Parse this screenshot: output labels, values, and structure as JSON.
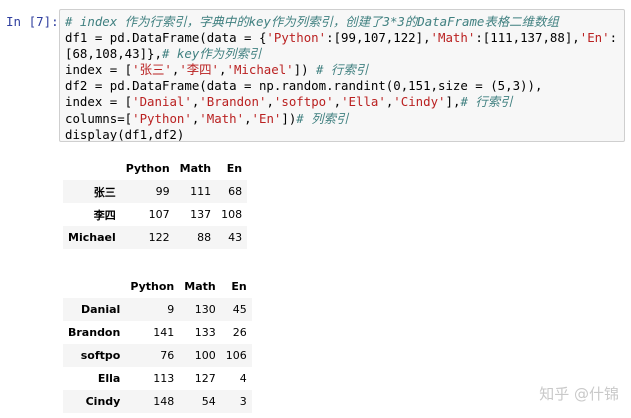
{
  "cell": {
    "prompt": "In [7]:",
    "code_lines": [
      [
        [
          "cm",
          "# index 作为行索引，字典中的key作为列索引，创建了3*3的DataFrame表格二维数组"
        ]
      ],
      [
        [
          "",
          "df1 = pd.DataFrame(data = {"
        ],
        [
          "st",
          "'Python'"
        ],
        [
          "",
          ":[99,107,122],"
        ],
        [
          "st",
          "'Math'"
        ],
        [
          "",
          ":[111,137,88],"
        ],
        [
          "st",
          "'En'"
        ],
        [
          "",
          ":"
        ]
      ],
      [
        [
          "",
          "[68,108,43]},"
        ],
        [
          "cm",
          "# key作为列索引"
        ]
      ],
      [
        [
          "",
          "index = ["
        ],
        [
          "st",
          "'张三'"
        ],
        [
          "",
          ","
        ],
        [
          "st",
          "'李四'"
        ],
        [
          "",
          ","
        ],
        [
          "st",
          "'Michael'"
        ],
        [
          "",
          "]) "
        ],
        [
          "cm",
          "# 行索引"
        ]
      ],
      [
        [
          "",
          "df2 = pd.DataFrame(data = np.random.randint(0,151,size = (5,3)),"
        ]
      ],
      [
        [
          "",
          "index = ["
        ],
        [
          "st",
          "'Danial'"
        ],
        [
          "",
          ","
        ],
        [
          "st",
          "'Brandon'"
        ],
        [
          "",
          ","
        ],
        [
          "st",
          "'softpo'"
        ],
        [
          "",
          ","
        ],
        [
          "st",
          "'Ella'"
        ],
        [
          "",
          ","
        ],
        [
          "st",
          "'Cindy'"
        ],
        [
          "",
          "],"
        ],
        [
          "cm",
          "# 行索引"
        ]
      ],
      [
        [
          "",
          "columns=["
        ],
        [
          "st",
          "'Python'"
        ],
        [
          "",
          ","
        ],
        [
          "st",
          "'Math'"
        ],
        [
          "",
          ","
        ],
        [
          "st",
          "'En'"
        ],
        [
          "",
          "])"
        ],
        [
          "cm",
          "# 列索引"
        ]
      ],
      [
        [
          "",
          "display(df1,df2)"
        ]
      ]
    ]
  },
  "df1": {
    "columns": [
      "Python",
      "Math",
      "En"
    ],
    "rows": [
      {
        "index": "张三",
        "values": [
          "99",
          "111",
          "68"
        ]
      },
      {
        "index": "李四",
        "values": [
          "107",
          "137",
          "108"
        ]
      },
      {
        "index": "Michael",
        "values": [
          "122",
          "88",
          "43"
        ]
      }
    ]
  },
  "df2": {
    "columns": [
      "Python",
      "Math",
      "En"
    ],
    "rows": [
      {
        "index": "Danial",
        "values": [
          "9",
          "130",
          "45"
        ]
      },
      {
        "index": "Brandon",
        "values": [
          "141",
          "133",
          "26"
        ]
      },
      {
        "index": "softpo",
        "values": [
          "76",
          "100",
          "106"
        ]
      },
      {
        "index": "Ella",
        "values": [
          "113",
          "127",
          "4"
        ]
      },
      {
        "index": "Cindy",
        "values": [
          "148",
          "54",
          "3"
        ]
      }
    ]
  },
  "watermark": "知乎 @什锦"
}
